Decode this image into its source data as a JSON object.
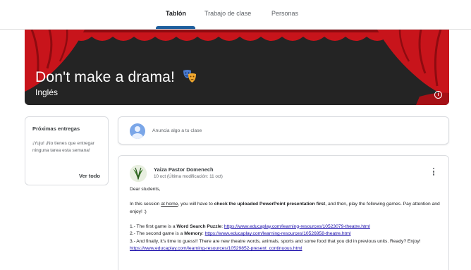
{
  "tabs": [
    {
      "label": "Tablón",
      "active": true
    },
    {
      "label": "Trabajo de clase",
      "active": false
    },
    {
      "label": "Personas",
      "active": false
    }
  ],
  "banner": {
    "title": "Don't make a drama!",
    "subtitle": "Inglés",
    "emoji_icon": "theater-masks-icon",
    "info_icon": "info-icon",
    "colors": {
      "curtain": "#c8141b",
      "background": "#242424"
    }
  },
  "upcoming": {
    "title": "Próximas entregas",
    "text": "¡Yuju! ¡No tienes que entregar ninguna tarea esta semana!",
    "view_all": "Ver todo"
  },
  "announce": {
    "placeholder": "Anuncia algo a tu clase"
  },
  "post": {
    "author": "Yaiza Pastor Domenech",
    "date": "10 oct (Última modificación: 11 oct)",
    "menu_icon": "more-vert-icon",
    "greeting": "Dear students,",
    "p1_a": "In this session ",
    "p1_link": "at home",
    "p1_b": ", you will have to ",
    "p1_bold": "check the uploaded PowerPoint presentation first",
    "p1_c": ", and then, play the following games. Pay attention and enjoy! :)",
    "l1_a": "1.- The first game is a ",
    "l1_bold": "Word Search Puzzle",
    "l1_b": ": ",
    "l1_url": "https://www.educaplay.com/learning-resources/10523079-theatre.html",
    "l2_a": "2.- The second game is a ",
    "l2_bold": "Memory",
    "l2_b": ": ",
    "l2_url": "https://www.educaplay.com/learning-resources/10526958-theatre.html",
    "l3_a": "3.- And finally, it's time to guess!! There are new theatre words, animals, sports and some food that you did in previous units. Ready? Enjoy!",
    "l3_url": "https://www.educaplay.com/learning-resources/10529852-present_continuous.html"
  }
}
